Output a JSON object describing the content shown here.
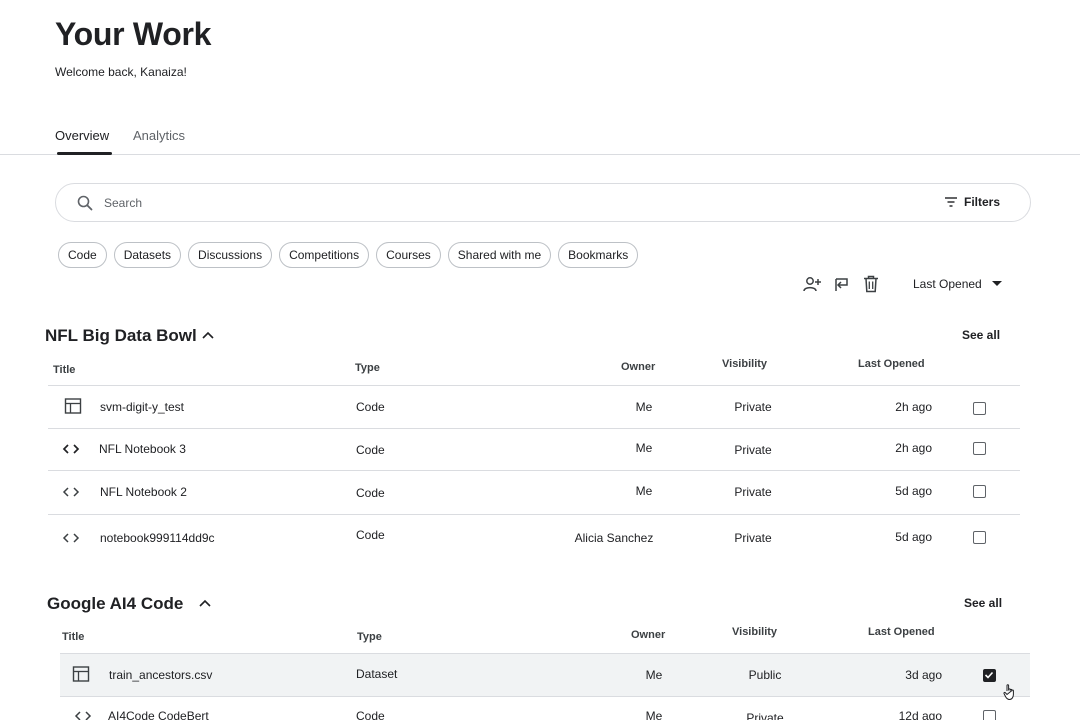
{
  "header": {
    "title": "Your Work",
    "welcome": "Welcome back, Kanaiza!"
  },
  "tabs": [
    {
      "label": "Overview",
      "active": true
    },
    {
      "label": "Analytics",
      "active": false
    }
  ],
  "search": {
    "placeholder": "Search",
    "filters_label": "Filters"
  },
  "chips": [
    "Code",
    "Datasets",
    "Discussions",
    "Competitions",
    "Courses",
    "Shared with me",
    "Bookmarks"
  ],
  "toolbar": {
    "icons": [
      "add-person-icon",
      "share-icon",
      "trash-icon"
    ],
    "sort_label": "Last Opened"
  },
  "columns": {
    "title": "Title",
    "type": "Type",
    "owner": "Owner",
    "visibility": "Visibility",
    "last_opened": "Last Opened"
  },
  "sections": [
    {
      "title": "NFL Big Data Bowl",
      "see_all": "See all",
      "rows": [
        {
          "icon": "table-icon",
          "title": "svm-digit-y_test",
          "type": "Code",
          "owner": "Me",
          "visibility": "Private",
          "last_opened": "2h ago",
          "checked": false
        },
        {
          "icon": "code-icon",
          "title": "NFL Notebook 3",
          "type": "Code",
          "owner": "Me",
          "visibility": "Private",
          "last_opened": "2h ago",
          "checked": false
        },
        {
          "icon": "code-icon",
          "title": "NFL Notebook 2",
          "type": "Code",
          "owner": "Me",
          "visibility": "Private",
          "last_opened": "5d ago",
          "checked": false
        },
        {
          "icon": "code-icon",
          "title": "notebook999114dd9c",
          "type": "Code",
          "owner": "Alicia Sanchez",
          "visibility": "Private",
          "last_opened": "5d ago",
          "checked": false
        }
      ]
    },
    {
      "title": "Google AI4 Code",
      "see_all": "See all",
      "rows": [
        {
          "icon": "table-icon",
          "title": "train_ancestors.csv",
          "type": "Dataset",
          "owner": "Me",
          "visibility": "Public",
          "last_opened": "3d ago",
          "checked": true
        },
        {
          "icon": "code-icon",
          "title": "AI4Code CodeBert",
          "type": "Code",
          "owner": "Me",
          "visibility": "Private",
          "last_opened": "12d ago",
          "checked": false
        }
      ]
    }
  ]
}
